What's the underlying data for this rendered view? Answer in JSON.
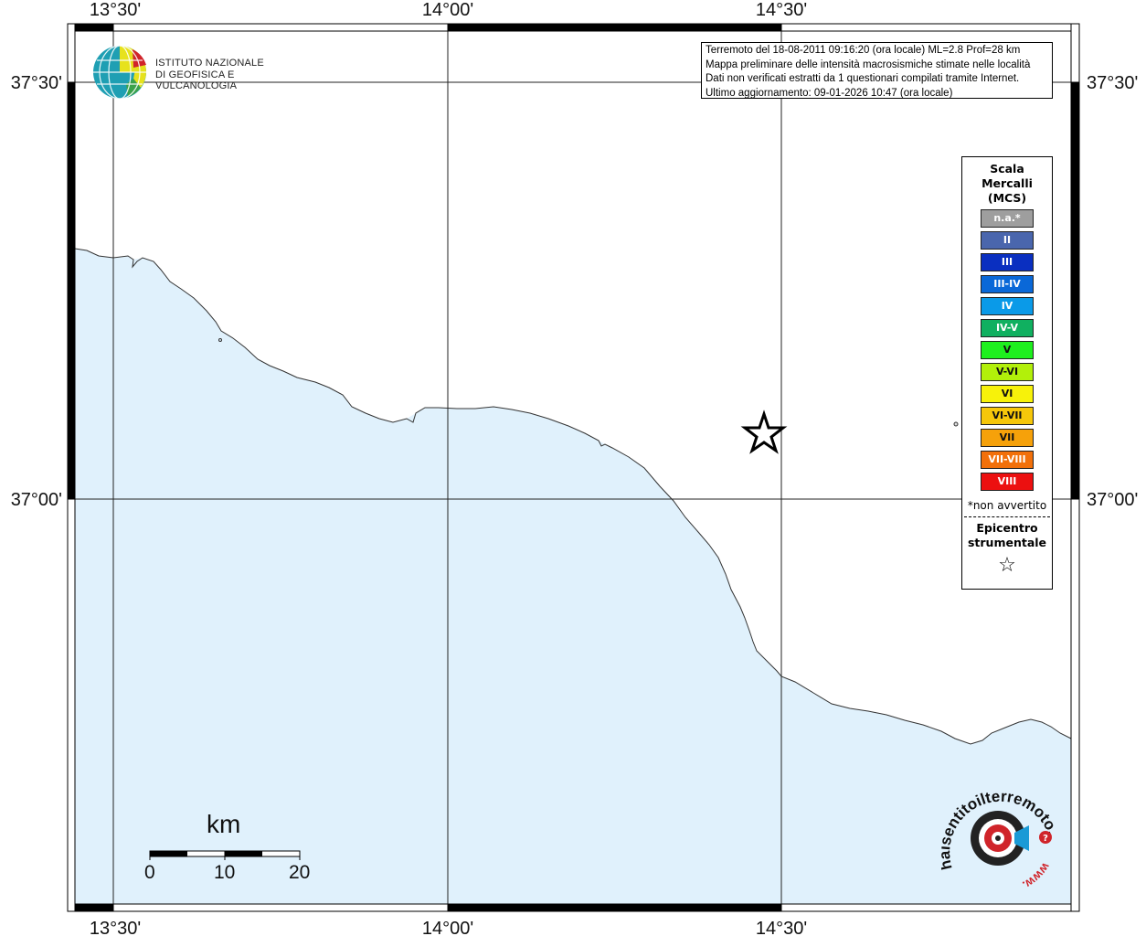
{
  "map": {
    "lon_ticks": [
      "13°30'",
      "14°00'",
      "14°30'"
    ],
    "lat_ticks": [
      "37°30'",
      "37°00'"
    ],
    "land_color": "#ffffff",
    "sea_color": "#e0f1fc",
    "epicenter_symbol": "star"
  },
  "logo": {
    "line1": "ISTITUTO NAZIONALE",
    "line2": "DI GEOFISICA E VULCANOLOGIA",
    "icon": "ingv-globe-icon"
  },
  "info": {
    "line1": "Terremoto del 18-08-2011 09:16:20 (ora locale) ML=2.8 Prof=28 km",
    "line2": "Mappa preliminare delle intensità macrosismiche stimate nelle località",
    "line3": "Dati non verificati estratti da 1 questionari compilati tramite Internet.",
    "line4": "Ultimo aggiornamento: 09-01-2026 10:47 (ora locale)"
  },
  "legend": {
    "title1": "Scala",
    "title2": "Mercalli",
    "title3": "(MCS)",
    "items": [
      {
        "label": "n.a.*",
        "color": "#9e9e9e"
      },
      {
        "label": "II",
        "color": "#4a66ad"
      },
      {
        "label": "III",
        "color": "#0a2fc0"
      },
      {
        "label": "III-IV",
        "color": "#0a68d8"
      },
      {
        "label": "IV",
        "color": "#0a9ae8"
      },
      {
        "label": "IV-V",
        "color": "#10b060"
      },
      {
        "label": "V",
        "color": "#1ef01e"
      },
      {
        "label": "V-VI",
        "color": "#b2f00a"
      },
      {
        "label": "VI",
        "color": "#f7f20a"
      },
      {
        "label": "VI-VII",
        "color": "#f6c70a"
      },
      {
        "label": "VII",
        "color": "#f6a10a"
      },
      {
        "label": "VII-VIII",
        "color": "#f2700a"
      },
      {
        "label": "VIII",
        "color": "#ec1010"
      }
    ],
    "note": "*non avvertito",
    "epi1": "Epicentro",
    "epi2": "strumentale",
    "epi_symbol": "☆"
  },
  "scale_bar": {
    "unit": "km",
    "labels": [
      "0",
      "10",
      "20"
    ]
  },
  "badge": {
    "text_top": "haisentitoilterremoto.it",
    "text_bottom": "www.",
    "icon": "haisentito-badge-icon"
  }
}
